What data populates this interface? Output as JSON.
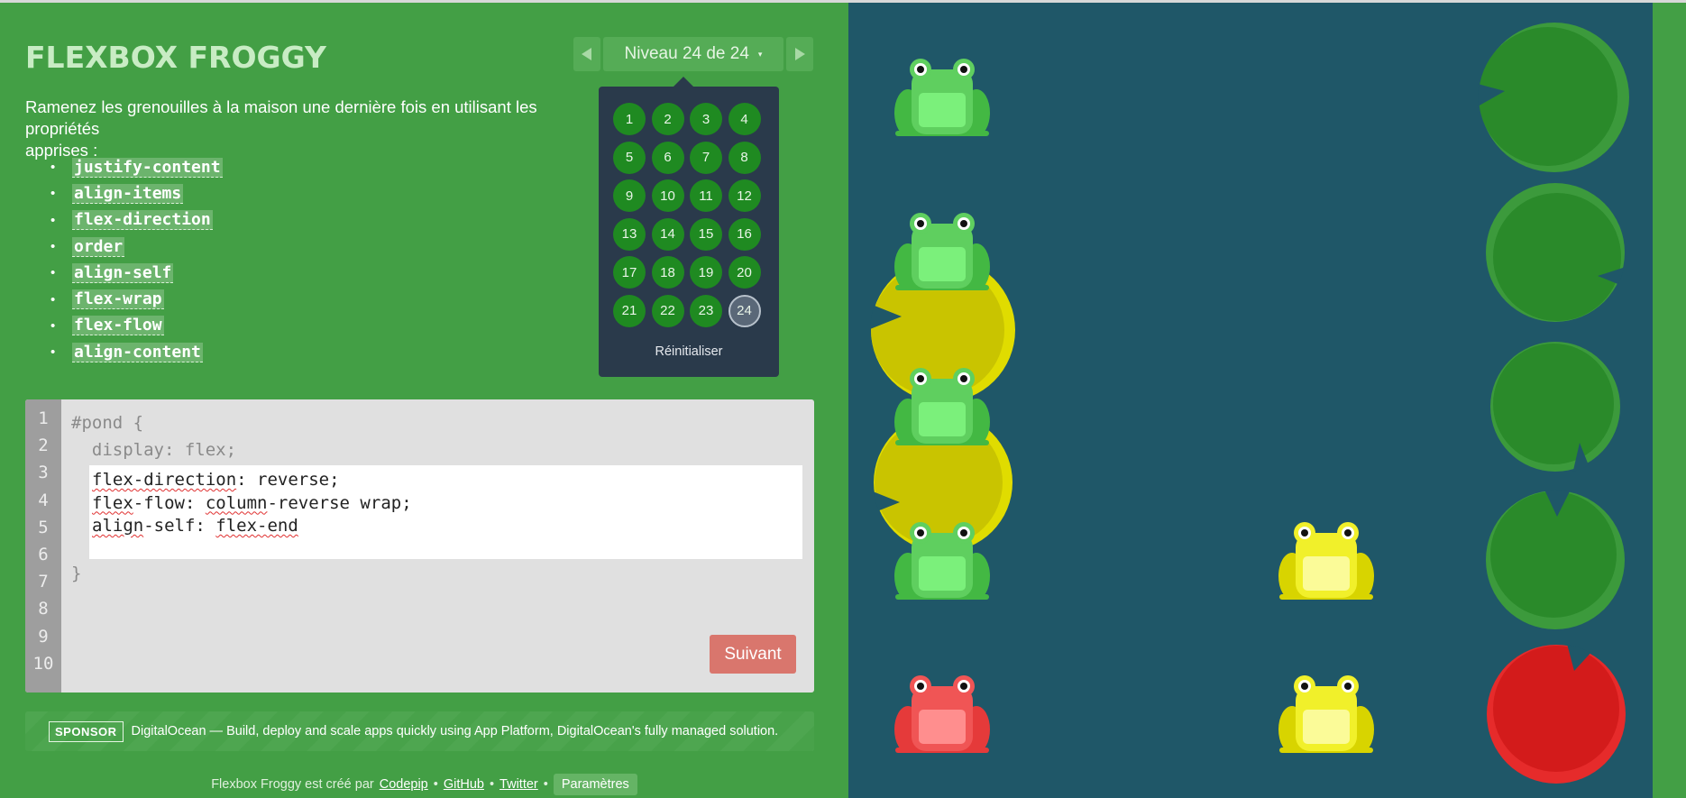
{
  "header": {
    "title": "FLEXBOX FROGGY",
    "level_label": "Niveau 24 de 24",
    "prev_icon": "triangle-left",
    "next_icon": "triangle-right",
    "caret": "▾"
  },
  "instructions": {
    "line1": "Ramenez les grenouilles à la maison une dernière fois en utilisant les propriétés",
    "line2": "apprises :"
  },
  "properties": [
    "justify-content",
    "align-items",
    "flex-direction",
    "order",
    "align-self",
    "flex-wrap",
    "flex-flow",
    "align-content"
  ],
  "level_panel": {
    "levels": [
      "1",
      "2",
      "3",
      "4",
      "5",
      "6",
      "7",
      "8",
      "9",
      "10",
      "11",
      "12",
      "13",
      "14",
      "15",
      "16",
      "17",
      "18",
      "19",
      "20",
      "21",
      "22",
      "23",
      "24"
    ],
    "current": "24",
    "reset_label": "Réinitialiser"
  },
  "editor": {
    "line_numbers": [
      "1",
      "2",
      "3",
      "4",
      "5",
      "6",
      "7",
      "8",
      "9",
      "10"
    ],
    "line1": "#pond {",
    "line2": "  display: flex;",
    "input": {
      "l1a": "flex-direction",
      "l1b": ": reverse;",
      "l2a": "flex",
      "l2b": "-flow: ",
      "l2c": "column",
      "l2d": "-reverse wrap;",
      "l3a": "align",
      "l3b": "-self: ",
      "l3c": "flex-end"
    },
    "line7": "}",
    "next_label": "Suivant"
  },
  "sponsor": {
    "tag": "SPONSOR",
    "text": "DigitalOcean — Build, deploy and scale apps quickly using App Platform, DigitalOcean's fully managed solution."
  },
  "footer": {
    "prefix": "Flexbox Froggy est créé par",
    "link1": "Codepip",
    "sep": "•",
    "link2": "GitHub",
    "link3": "Twitter",
    "settings": "Paramètres"
  },
  "colors": {
    "sidebar": "#439f45",
    "pond": "#1f5768",
    "frog_green": "#5fcf5f",
    "frog_yellow": "#f1f02a",
    "frog_red": "#f05555",
    "pad_green": "#2a8a2a",
    "pad_yellow": "#c9c400",
    "pad_red": "#d31b1b",
    "next_button": "#d9766d"
  }
}
